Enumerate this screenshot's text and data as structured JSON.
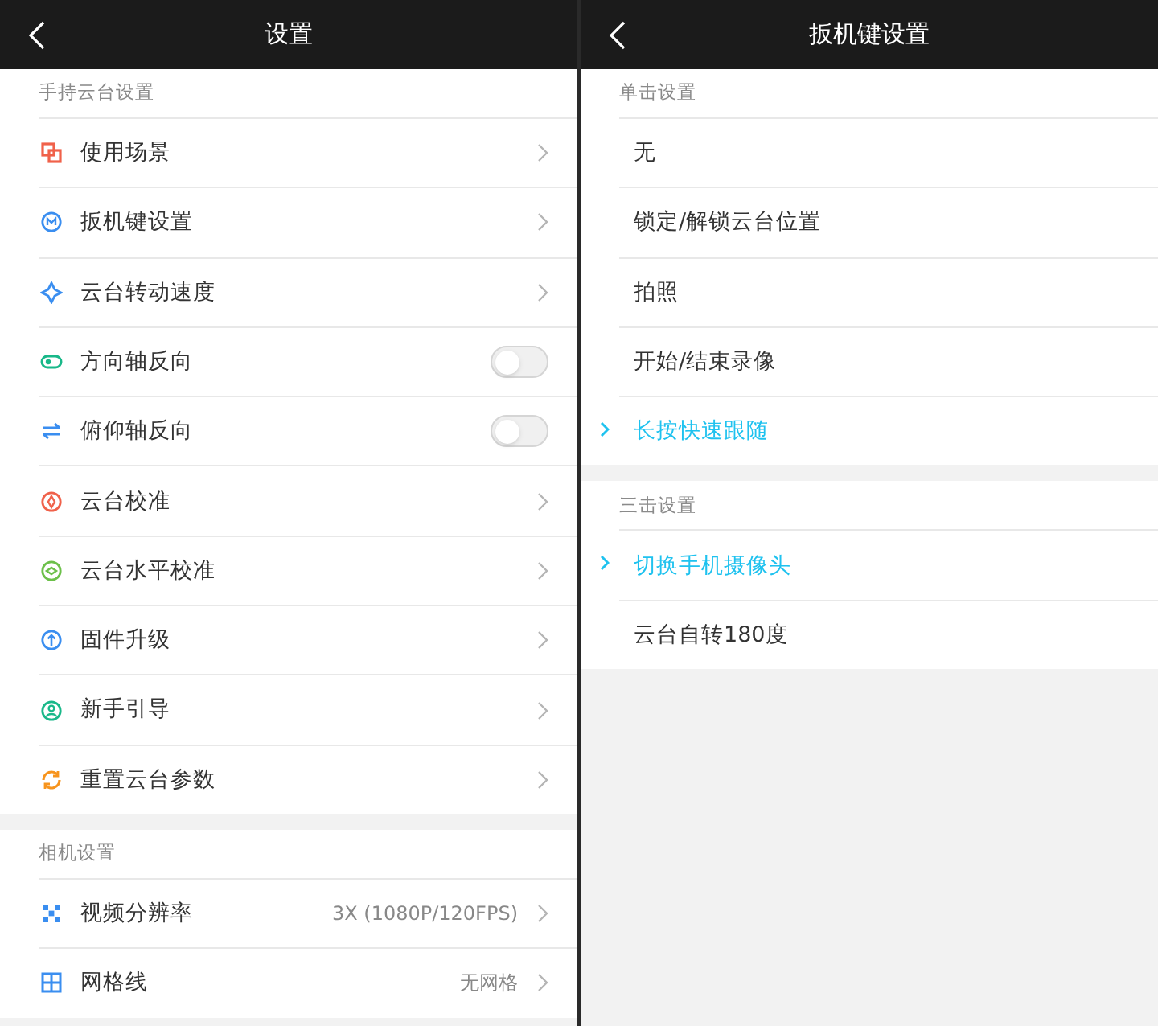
{
  "left": {
    "title": "设置",
    "sections": [
      {
        "label": "手持云台设置",
        "items": [
          {
            "kind": "link",
            "label": "使用场景"
          },
          {
            "kind": "link",
            "label": "扳机键设置"
          },
          {
            "kind": "link",
            "label": "云台转动速度"
          },
          {
            "kind": "toggle",
            "label": "方向轴反向",
            "on": false
          },
          {
            "kind": "toggle",
            "label": "俯仰轴反向",
            "on": false
          },
          {
            "kind": "link",
            "label": "云台校准"
          },
          {
            "kind": "link",
            "label": "云台水平校准"
          },
          {
            "kind": "link",
            "label": "固件升级"
          },
          {
            "kind": "link",
            "label": "新手引导"
          },
          {
            "kind": "link",
            "label": "重置云台参数"
          }
        ]
      },
      {
        "label": "相机设置",
        "items": [
          {
            "kind": "link",
            "label": "视频分辨率",
            "value": "3X (1080P/120FPS)"
          },
          {
            "kind": "link",
            "label": "网格线",
            "value": "无网格"
          }
        ]
      }
    ]
  },
  "right": {
    "title": "扳机键设置",
    "sections": [
      {
        "label": "单击设置",
        "options": [
          {
            "label": "无",
            "selected": false
          },
          {
            "label": "锁定/解锁云台位置",
            "selected": false
          },
          {
            "label": "拍照",
            "selected": false
          },
          {
            "label": "开始/结束录像",
            "selected": false
          },
          {
            "label": "长按快速跟随",
            "selected": true
          }
        ]
      },
      {
        "label": "三击设置",
        "options": [
          {
            "label": "切换手机摄像头",
            "selected": true
          },
          {
            "label": "云台自转180度",
            "selected": false
          }
        ]
      }
    ]
  }
}
